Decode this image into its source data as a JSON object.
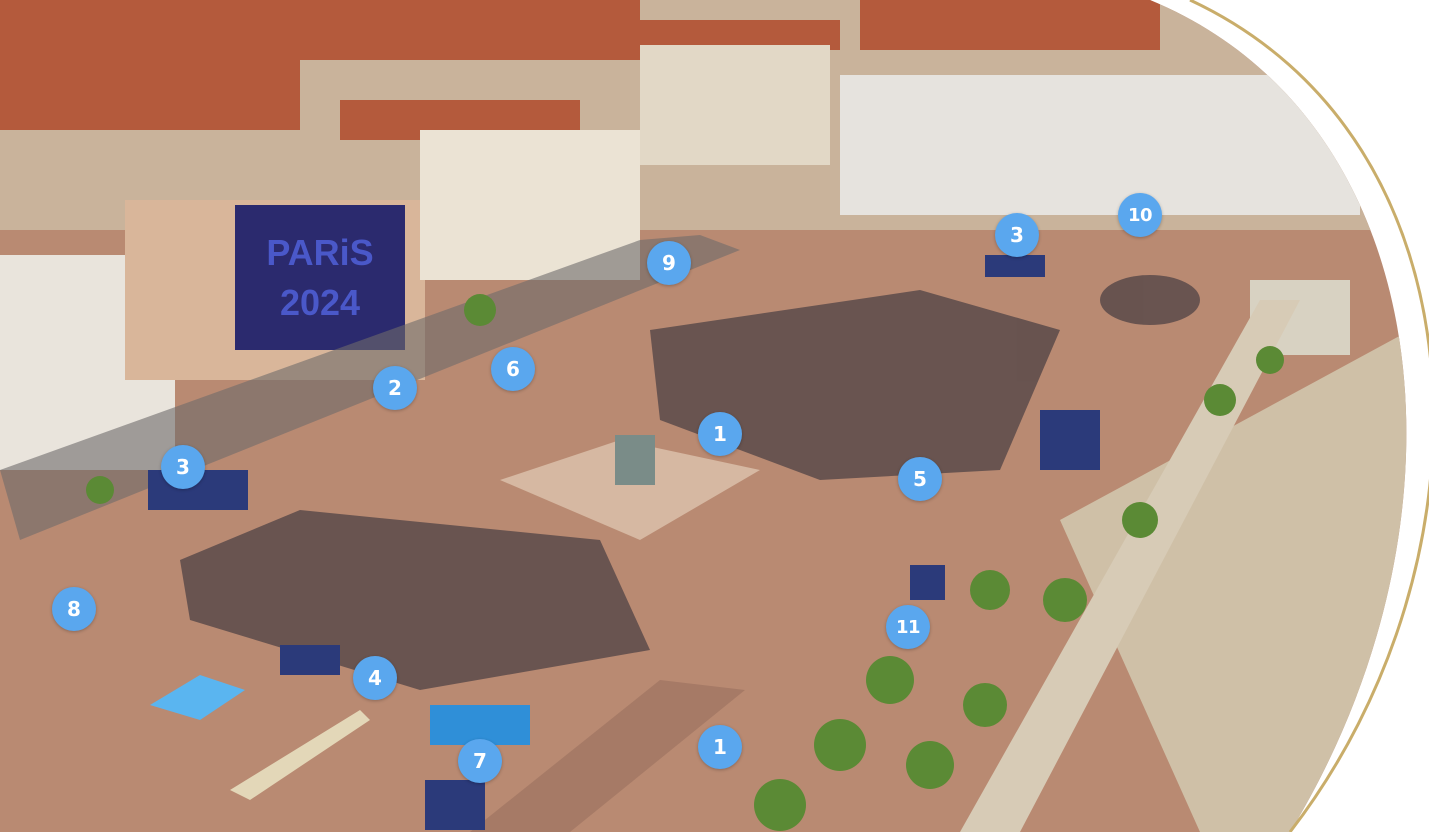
{
  "colors": {
    "marker": "#5aa7ee",
    "ground": "#b98a72",
    "border_gold": "#c9ad6a",
    "buildings_roof": "#b45a3c",
    "trees": "#5b8a35",
    "crowd": "#5a4a4a",
    "banner": "#2b2a6e"
  },
  "banner": {
    "line1": "PARiS",
    "line2": "2024"
  },
  "markers": [
    {
      "id": "m1a",
      "label": "1"
    },
    {
      "id": "m1b",
      "label": "1"
    },
    {
      "id": "m2",
      "label": "2"
    },
    {
      "id": "m3a",
      "label": "3"
    },
    {
      "id": "m3b",
      "label": "3"
    },
    {
      "id": "m4",
      "label": "4"
    },
    {
      "id": "m5",
      "label": "5"
    },
    {
      "id": "m6",
      "label": "6"
    },
    {
      "id": "m7",
      "label": "7"
    },
    {
      "id": "m8",
      "label": "8"
    },
    {
      "id": "m9",
      "label": "9"
    },
    {
      "id": "m10",
      "label": "10"
    },
    {
      "id": "m11",
      "label": "11"
    }
  ]
}
